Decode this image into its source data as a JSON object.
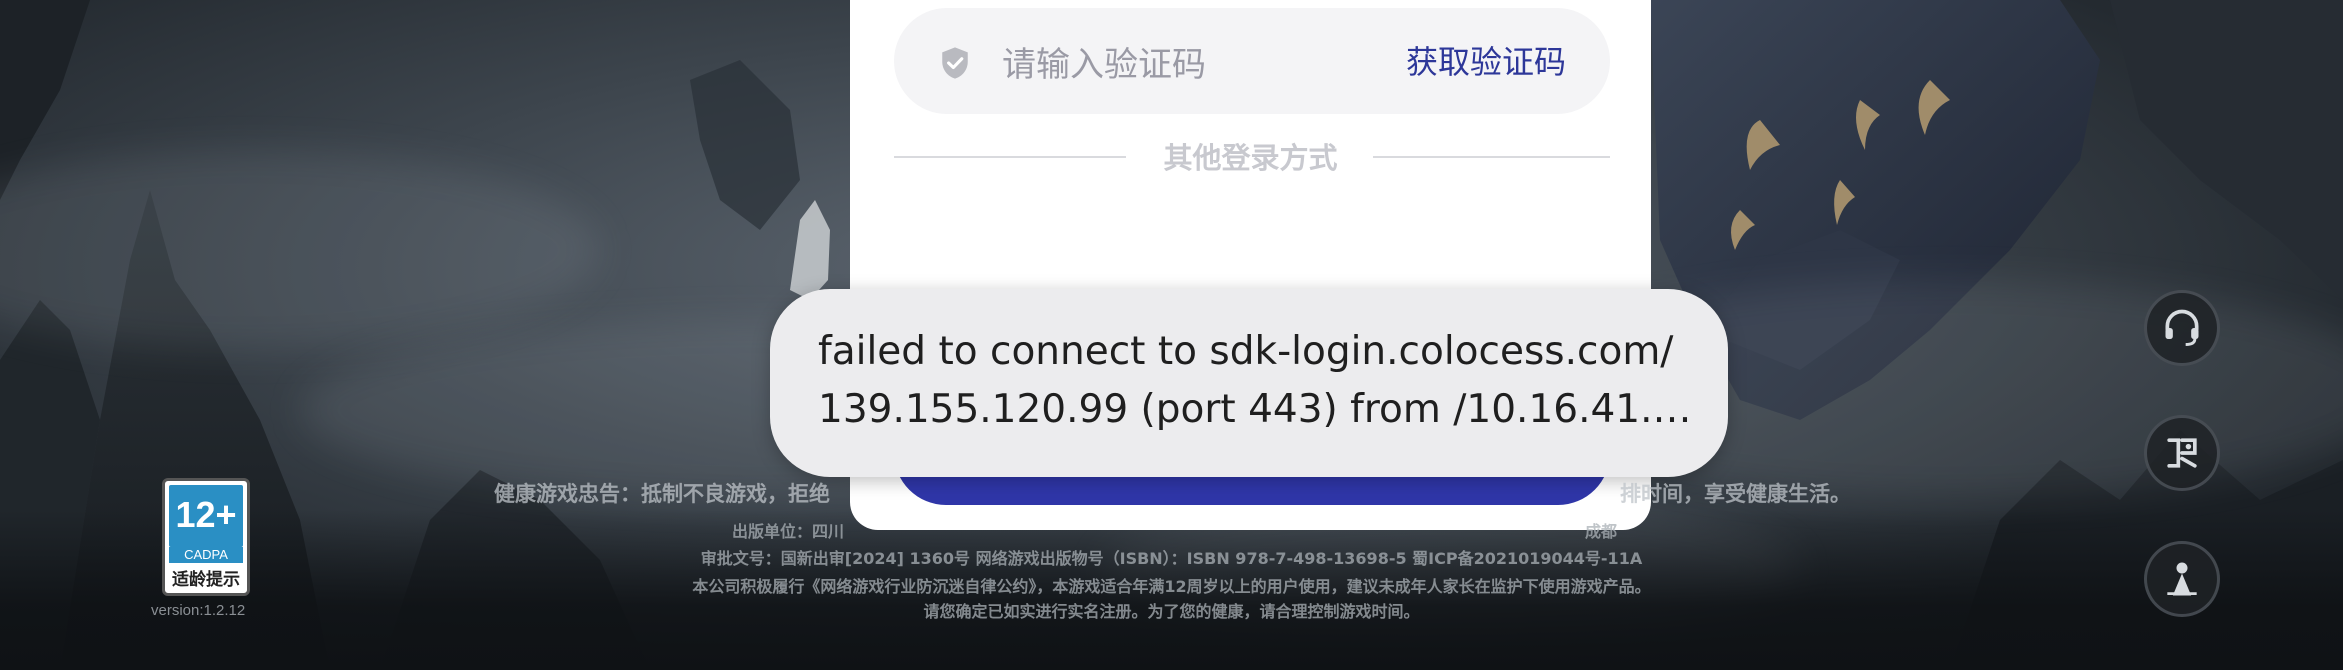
{
  "login": {
    "code_placeholder": "请输入验证码",
    "get_code_label": "获取验证码",
    "other_login_label": "其他登录方式"
  },
  "toast": {
    "line1": "failed to connect to sdk-login.colocess.com/",
    "line2": "139.155.120.99 (port 443) from /10.16.41.…"
  },
  "badge": {
    "age": "12+",
    "org": "CADPA",
    "tip": "适龄提示",
    "version": "version:1.2.12"
  },
  "footer": {
    "notice_left": "健康游戏忠告：抵制不良游戏，拒绝",
    "notice_right": "排时间，享受健康生活。",
    "publisher_left": "出版单位：四川",
    "publisher_right": "成都",
    "approval": "审批文号：国新出审[2024] 1360号 网络游戏出版物号（ISBN）：ISBN 978-7-498-13698-5 蜀ICP备2021019044号-11A",
    "convention": "本公司积极履行《网络游戏行业防沉迷自律公约》，本游戏适合年满12周岁以上的用户使用，建议未成年人家长在监护下使用游戏产品。",
    "realname": "请您确定已如实进行实名注册。为了您的健康，请合理控制游戏时间。"
  },
  "side_buttons": [
    "headset-icon",
    "gift-icon",
    "character-icon"
  ],
  "colors": {
    "accent": "#2f36a8",
    "link": "#2d3799"
  }
}
